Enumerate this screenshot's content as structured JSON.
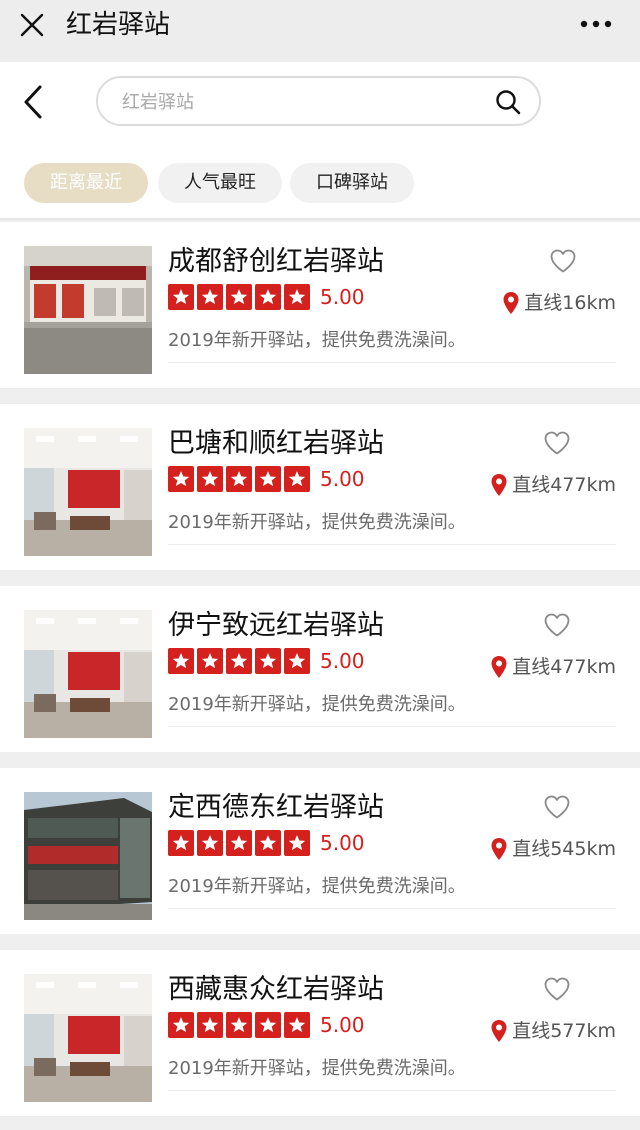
{
  "window": {
    "title": "红岩驿站"
  },
  "search": {
    "placeholder": "红岩驿站"
  },
  "filters": [
    {
      "label": "距离最近",
      "active": true
    },
    {
      "label": "人气最旺",
      "active": false
    },
    {
      "label": "口碑驿站",
      "active": false
    }
  ],
  "stations": [
    {
      "name": "成都舒创红岩驿站",
      "rating": "5.00",
      "stars": 5,
      "distance": "直线16km",
      "description": "2019年新开驿站，提供免费洗澡间。"
    },
    {
      "name": "巴塘和顺红岩驿站",
      "rating": "5.00",
      "stars": 5,
      "distance": "直线477km",
      "description": "2019年新开驿站，提供免费洗澡间。"
    },
    {
      "name": "伊宁致远红岩驿站",
      "rating": "5.00",
      "stars": 5,
      "distance": "直线477km",
      "description": "2019年新开驿站，提供免费洗澡间。"
    },
    {
      "name": "定西德东红岩驿站",
      "rating": "5.00",
      "stars": 5,
      "distance": "直线545km",
      "description": "2019年新开驿站，提供免费洗澡间。"
    },
    {
      "name": "西藏惠众红岩驿站",
      "rating": "5.00",
      "stars": 5,
      "distance": "直线577km",
      "description": "2019年新开驿站，提供免费洗澡间。"
    }
  ],
  "colors": {
    "accent_red": "#d5211e",
    "chip_active": "#e7dcc4",
    "chip_inactive": "#f1f1f1",
    "muted_text": "#6b6b6b"
  },
  "icons": {
    "close": "close-icon",
    "more": "more-icon",
    "back": "back-arrow-icon",
    "search": "search-icon",
    "favorite": "heart-outline-icon",
    "location": "location-pin-icon",
    "star": "star-icon"
  }
}
